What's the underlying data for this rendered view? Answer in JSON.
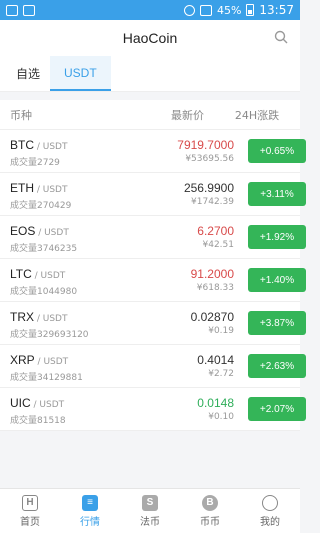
{
  "statusbar": {
    "battery_pct": "45%",
    "time": "13:57"
  },
  "header": {
    "title": "HaoCoin",
    "icons": {
      "search": "search-icon"
    }
  },
  "tabs": [
    {
      "label": "自选",
      "active": false
    },
    {
      "label": "USDT",
      "active": true
    }
  ],
  "columns": {
    "name": "币种",
    "price": "最新价",
    "change": "24H涨跌"
  },
  "rows": [
    {
      "symbol": "BTC",
      "quote": " / USDT",
      "volume": "成交量2729",
      "price": "7919.7000",
      "cny": "¥53695.56",
      "change": "+0.65%",
      "price_color": "red"
    },
    {
      "symbol": "ETH",
      "quote": " / USDT",
      "volume": "成交量270429",
      "price": "256.9900",
      "cny": "¥1742.39",
      "change": "+3.11%",
      "price_color": "dark"
    },
    {
      "symbol": "EOS",
      "quote": " / USDT",
      "volume": "成交量3746235",
      "price": "6.2700",
      "cny": "¥42.51",
      "change": "+1.92%",
      "price_color": "red"
    },
    {
      "symbol": "LTC",
      "quote": " / USDT",
      "volume": "成交量1044980",
      "price": "91.2000",
      "cny": "¥618.33",
      "change": "+1.40%",
      "price_color": "red"
    },
    {
      "symbol": "TRX",
      "quote": " / USDT",
      "volume": "成交量329693120",
      "price": "0.02870",
      "cny": "¥0.19",
      "change": "+3.87%",
      "price_color": "dark"
    },
    {
      "symbol": "XRP",
      "quote": " / USDT",
      "volume": "成交量34129881",
      "price": "0.4014",
      "cny": "¥2.72",
      "change": "+2.63%",
      "price_color": "dark"
    },
    {
      "symbol": "UIC",
      "quote": " / USDT",
      "volume": "成交量81518",
      "price": "0.0148",
      "cny": "¥0.10",
      "change": "+2.07%",
      "price_color": "green"
    }
  ],
  "nav": [
    {
      "label": "首页",
      "glyph": "H",
      "icon": "home-icon"
    },
    {
      "label": "行情",
      "glyph": "≡",
      "icon": "market-icon",
      "active": true
    },
    {
      "label": "法币",
      "glyph": "S",
      "icon": "fiat-icon"
    },
    {
      "label": "币币",
      "glyph": "B",
      "icon": "coin-trade-icon"
    },
    {
      "label": "我的",
      "glyph": "",
      "icon": "profile-icon"
    }
  ],
  "colors": {
    "accent": "#3aa0e8",
    "up_chip": "#34b558",
    "price_red": "#d84a4a",
    "price_green": "#2fae5a"
  }
}
